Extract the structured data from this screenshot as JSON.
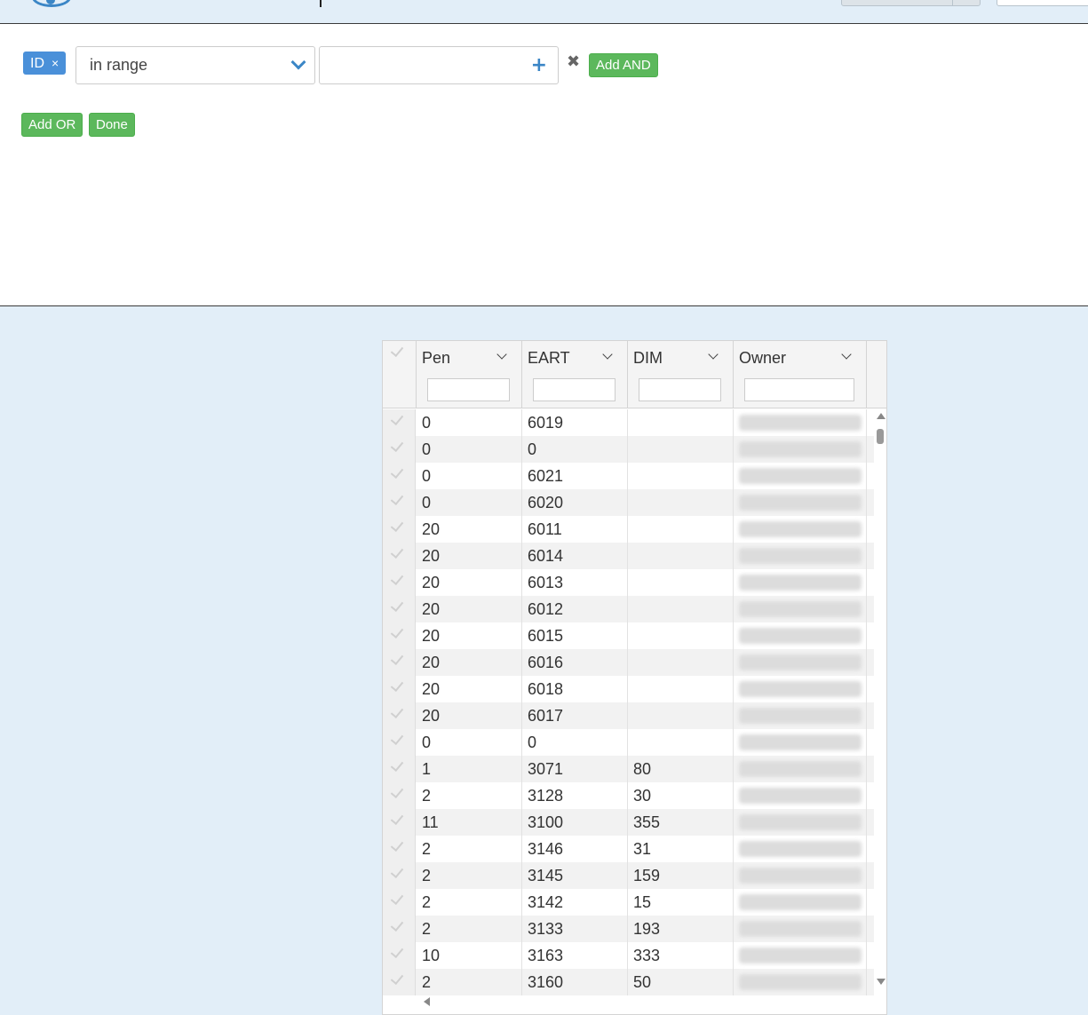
{
  "filter": {
    "field_tag": "ID",
    "tag_remove": "×",
    "operator": "in range",
    "value_placeholder": "",
    "remove_symbol": "✖",
    "add_and_label": "Add AND",
    "add_or_label": "Add OR",
    "done_label": "Done"
  },
  "grid": {
    "columns": [
      {
        "label": "Pen"
      },
      {
        "label": "EART"
      },
      {
        "label": "DIM"
      },
      {
        "label": "Owner"
      }
    ],
    "rows": [
      {
        "pen": "0",
        "eart": "6019",
        "dim": ""
      },
      {
        "pen": "0",
        "eart": "0",
        "dim": ""
      },
      {
        "pen": "0",
        "eart": "6021",
        "dim": ""
      },
      {
        "pen": "0",
        "eart": "6020",
        "dim": ""
      },
      {
        "pen": "20",
        "eart": "6011",
        "dim": ""
      },
      {
        "pen": "20",
        "eart": "6014",
        "dim": ""
      },
      {
        "pen": "20",
        "eart": "6013",
        "dim": ""
      },
      {
        "pen": "20",
        "eart": "6012",
        "dim": ""
      },
      {
        "pen": "20",
        "eart": "6015",
        "dim": ""
      },
      {
        "pen": "20",
        "eart": "6016",
        "dim": ""
      },
      {
        "pen": "20",
        "eart": "6018",
        "dim": ""
      },
      {
        "pen": "20",
        "eart": "6017",
        "dim": ""
      },
      {
        "pen": "0",
        "eart": "0",
        "dim": ""
      },
      {
        "pen": "1",
        "eart": "3071",
        "dim": "80"
      },
      {
        "pen": "2",
        "eart": "3128",
        "dim": "30"
      },
      {
        "pen": "11",
        "eart": "3100",
        "dim": "355"
      },
      {
        "pen": "2",
        "eart": "3146",
        "dim": "31"
      },
      {
        "pen": "2",
        "eart": "3145",
        "dim": "159"
      },
      {
        "pen": "2",
        "eart": "3142",
        "dim": "15"
      },
      {
        "pen": "2",
        "eart": "3133",
        "dim": "193"
      },
      {
        "pen": "10",
        "eart": "3163",
        "dim": "333"
      },
      {
        "pen": "2",
        "eart": "3160",
        "dim": "50"
      }
    ]
  },
  "colors": {
    "page_bg": "#e2eef8",
    "tag_blue": "#4a90d9",
    "button_green": "#5cb85c",
    "accent_blue": "#3b86c6"
  }
}
